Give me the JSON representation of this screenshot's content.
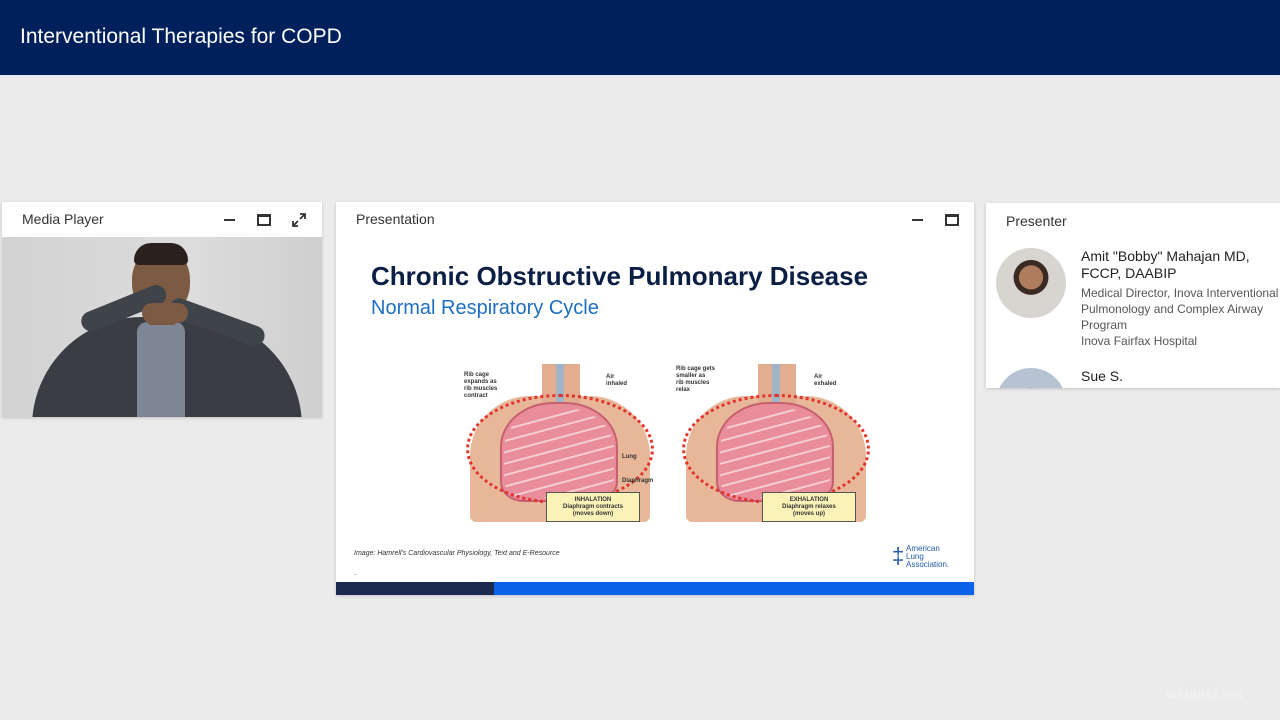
{
  "window": {
    "title": "Interventional Therapies for COPD"
  },
  "media_player": {
    "title": "Media Player",
    "controls": [
      "minimize-icon",
      "window-icon",
      "expand-icon"
    ]
  },
  "presentation": {
    "title": "Presentation",
    "controls": [
      "minimize-icon",
      "window-icon"
    ],
    "slide": {
      "title": "Chronic Obstructive Pulmonary Disease",
      "subtitle": "Normal Respiratory Cycle",
      "figure_left": {
        "label_ribs": "Rib cage\nexpands as\nrib muscles\ncontract",
        "label_air": "Air\ninhaled",
        "label_lung": "Lung",
        "label_diaphragm": "Diaphragm",
        "caption": "INHALATION\nDiaphragm contracts\n(moves down)"
      },
      "figure_right": {
        "label_ribs": "Rib cage gets\nsmaller as\nrib muscles\nrelax",
        "label_air": "Air\nexhaled",
        "caption": "EXHALATION\nDiaphragm relaxes\n(moves up)"
      },
      "credit": "Image: Hamrell's Cardiovascular Physiology, Text and E-Resource",
      "dot": ".",
      "logo": {
        "mark": "‡",
        "text": "American\nLung\nAssociation."
      }
    }
  },
  "presenter_panel": {
    "title": "Presenter",
    "presenters": [
      {
        "name": "Amit \"Bobby\" Mahajan MD, FCCP, DAABIP",
        "role": "Medical Director, Inova Interventional Pulmonology and Complex Airway Program",
        "org": "Inova Fairfax Hospital"
      },
      {
        "name": "Sue S."
      }
    ]
  },
  "branding": {
    "line1": "Delivered by",
    "line2": "webinar.net"
  },
  "colors": {
    "header": "#00205b",
    "accent_blue": "#0a62e8",
    "title_navy": "#0b1f44",
    "subtitle_blue": "#1e6fc2"
  }
}
